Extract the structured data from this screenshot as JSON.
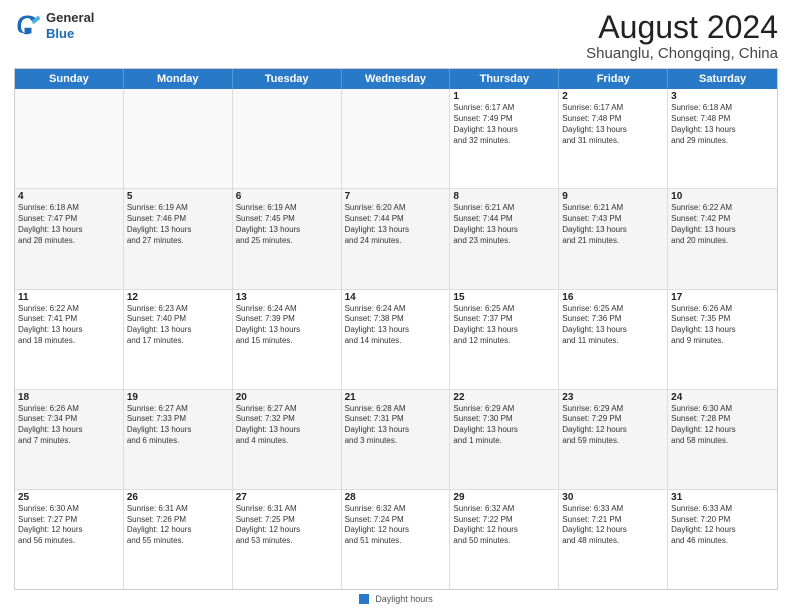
{
  "header": {
    "logo_general": "General",
    "logo_blue": "Blue",
    "title": "August 2024",
    "subtitle": "Shuanglu, Chongqing, China"
  },
  "calendar": {
    "days_of_week": [
      "Sunday",
      "Monday",
      "Tuesday",
      "Wednesday",
      "Thursday",
      "Friday",
      "Saturday"
    ],
    "weeks": [
      [
        {
          "day": "",
          "info": "",
          "empty": true
        },
        {
          "day": "",
          "info": "",
          "empty": true
        },
        {
          "day": "",
          "info": "",
          "empty": true
        },
        {
          "day": "",
          "info": "",
          "empty": true
        },
        {
          "day": "1",
          "info": "Sunrise: 6:17 AM\nSunset: 7:49 PM\nDaylight: 13 hours\nand 32 minutes."
        },
        {
          "day": "2",
          "info": "Sunrise: 6:17 AM\nSunset: 7:48 PM\nDaylight: 13 hours\nand 31 minutes."
        },
        {
          "day": "3",
          "info": "Sunrise: 6:18 AM\nSunset: 7:48 PM\nDaylight: 13 hours\nand 29 minutes."
        }
      ],
      [
        {
          "day": "4",
          "info": "Sunrise: 6:18 AM\nSunset: 7:47 PM\nDaylight: 13 hours\nand 28 minutes."
        },
        {
          "day": "5",
          "info": "Sunrise: 6:19 AM\nSunset: 7:46 PM\nDaylight: 13 hours\nand 27 minutes."
        },
        {
          "day": "6",
          "info": "Sunrise: 6:19 AM\nSunset: 7:45 PM\nDaylight: 13 hours\nand 25 minutes."
        },
        {
          "day": "7",
          "info": "Sunrise: 6:20 AM\nSunset: 7:44 PM\nDaylight: 13 hours\nand 24 minutes."
        },
        {
          "day": "8",
          "info": "Sunrise: 6:21 AM\nSunset: 7:44 PM\nDaylight: 13 hours\nand 23 minutes."
        },
        {
          "day": "9",
          "info": "Sunrise: 6:21 AM\nSunset: 7:43 PM\nDaylight: 13 hours\nand 21 minutes."
        },
        {
          "day": "10",
          "info": "Sunrise: 6:22 AM\nSunset: 7:42 PM\nDaylight: 13 hours\nand 20 minutes."
        }
      ],
      [
        {
          "day": "11",
          "info": "Sunrise: 6:22 AM\nSunset: 7:41 PM\nDaylight: 13 hours\nand 18 minutes."
        },
        {
          "day": "12",
          "info": "Sunrise: 6:23 AM\nSunset: 7:40 PM\nDaylight: 13 hours\nand 17 minutes."
        },
        {
          "day": "13",
          "info": "Sunrise: 6:24 AM\nSunset: 7:39 PM\nDaylight: 13 hours\nand 15 minutes."
        },
        {
          "day": "14",
          "info": "Sunrise: 6:24 AM\nSunset: 7:38 PM\nDaylight: 13 hours\nand 14 minutes."
        },
        {
          "day": "15",
          "info": "Sunrise: 6:25 AM\nSunset: 7:37 PM\nDaylight: 13 hours\nand 12 minutes."
        },
        {
          "day": "16",
          "info": "Sunrise: 6:25 AM\nSunset: 7:36 PM\nDaylight: 13 hours\nand 11 minutes."
        },
        {
          "day": "17",
          "info": "Sunrise: 6:26 AM\nSunset: 7:35 PM\nDaylight: 13 hours\nand 9 minutes."
        }
      ],
      [
        {
          "day": "18",
          "info": "Sunrise: 6:26 AM\nSunset: 7:34 PM\nDaylight: 13 hours\nand 7 minutes."
        },
        {
          "day": "19",
          "info": "Sunrise: 6:27 AM\nSunset: 7:33 PM\nDaylight: 13 hours\nand 6 minutes."
        },
        {
          "day": "20",
          "info": "Sunrise: 6:27 AM\nSunset: 7:32 PM\nDaylight: 13 hours\nand 4 minutes."
        },
        {
          "day": "21",
          "info": "Sunrise: 6:28 AM\nSunset: 7:31 PM\nDaylight: 13 hours\nand 3 minutes."
        },
        {
          "day": "22",
          "info": "Sunrise: 6:29 AM\nSunset: 7:30 PM\nDaylight: 13 hours\nand 1 minute."
        },
        {
          "day": "23",
          "info": "Sunrise: 6:29 AM\nSunset: 7:29 PM\nDaylight: 12 hours\nand 59 minutes."
        },
        {
          "day": "24",
          "info": "Sunrise: 6:30 AM\nSunset: 7:28 PM\nDaylight: 12 hours\nand 58 minutes."
        }
      ],
      [
        {
          "day": "25",
          "info": "Sunrise: 6:30 AM\nSunset: 7:27 PM\nDaylight: 12 hours\nand 56 minutes."
        },
        {
          "day": "26",
          "info": "Sunrise: 6:31 AM\nSunset: 7:26 PM\nDaylight: 12 hours\nand 55 minutes."
        },
        {
          "day": "27",
          "info": "Sunrise: 6:31 AM\nSunset: 7:25 PM\nDaylight: 12 hours\nand 53 minutes."
        },
        {
          "day": "28",
          "info": "Sunrise: 6:32 AM\nSunset: 7:24 PM\nDaylight: 12 hours\nand 51 minutes."
        },
        {
          "day": "29",
          "info": "Sunrise: 6:32 AM\nSunset: 7:22 PM\nDaylight: 12 hours\nand 50 minutes."
        },
        {
          "day": "30",
          "info": "Sunrise: 6:33 AM\nSunset: 7:21 PM\nDaylight: 12 hours\nand 48 minutes."
        },
        {
          "day": "31",
          "info": "Sunrise: 6:33 AM\nSunset: 7:20 PM\nDaylight: 12 hours\nand 46 minutes."
        }
      ]
    ]
  },
  "footer": {
    "legend_label": "Daylight hours"
  }
}
